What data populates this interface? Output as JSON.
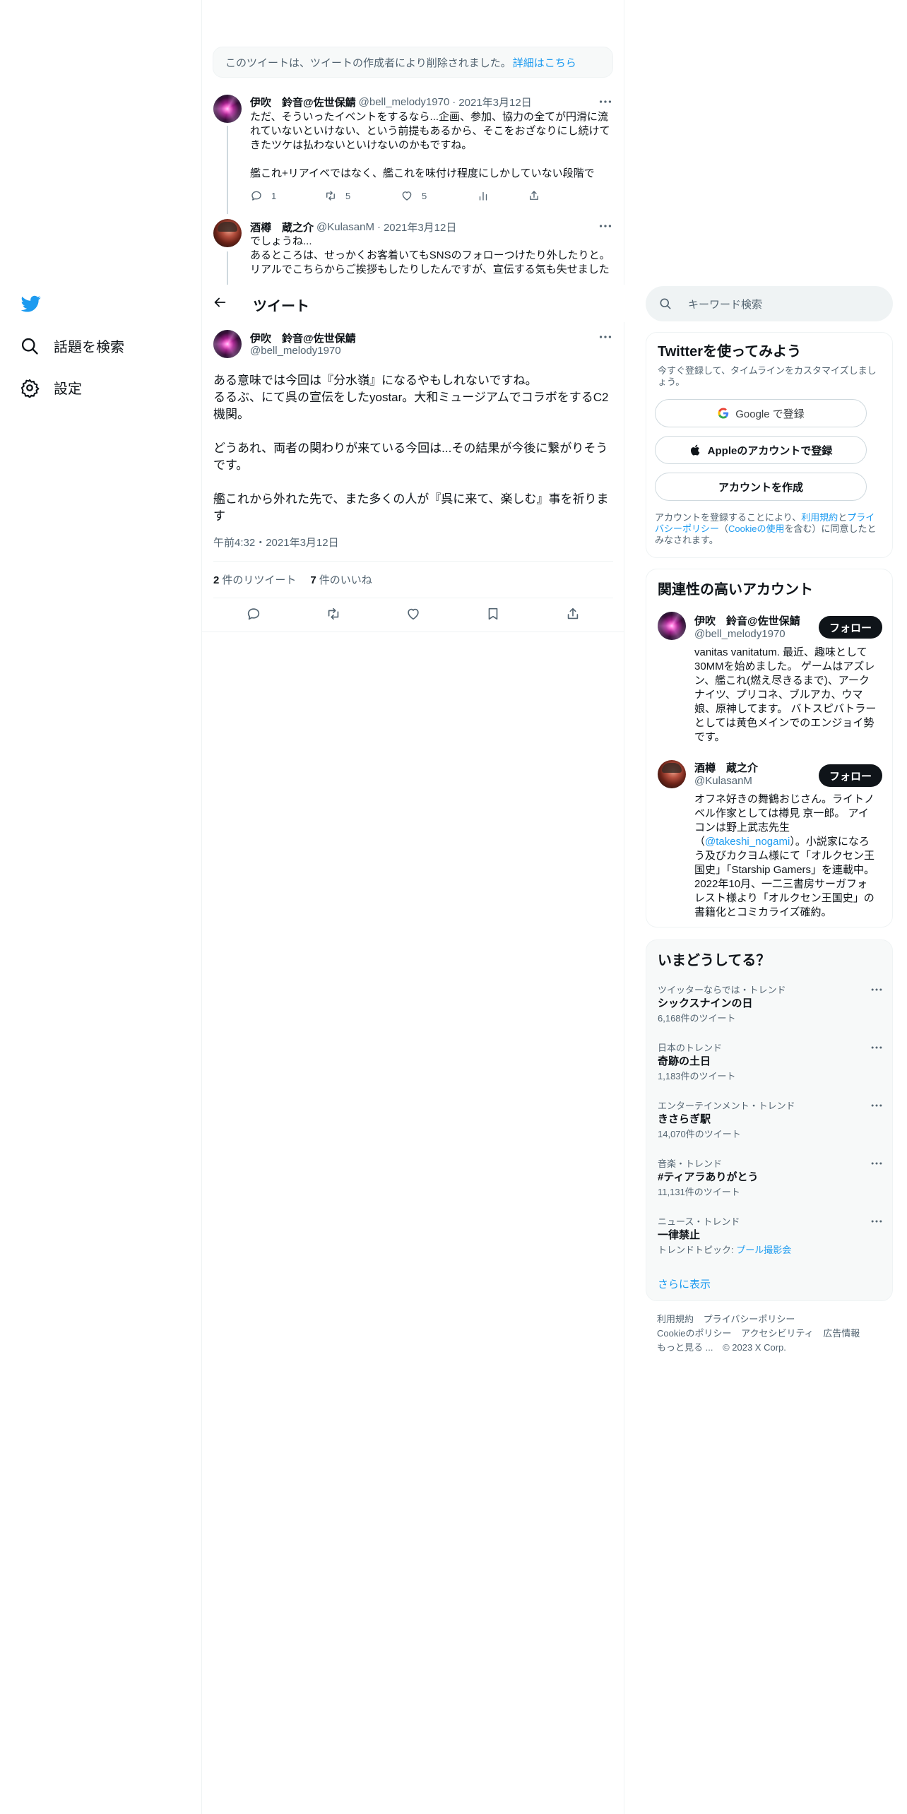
{
  "nav": {
    "items": [
      {
        "label": "話題を検索",
        "icon": "search-icon"
      },
      {
        "label": "設定",
        "icon": "gear-icon"
      }
    ]
  },
  "deleted_notice": {
    "text": "このツイートは、ツイートの作成者により削除されました。",
    "link": "詳細はこちら"
  },
  "thread": [
    {
      "name": "伊吹　鈴音@佐世保鯖",
      "handle": "@bell_melody1970",
      "date": "2021年3月12日",
      "text": "ただ、そういったイベントをするなら...企画、参加、協力の全てが円滑に流れていないといけない、という前提もあるから、そこをおざなりにし続けてきたツケは払わないといけないのかもですね。\n\n艦これ+リアイベではなく、艦これを味付け程度にしかしていない段階で",
      "replies": "1",
      "retweets": "5",
      "likes": "5"
    },
    {
      "name": "酒樽　蔵之介",
      "handle": "@KulasanM",
      "date": "2021年3月12日",
      "text": "でしょうね...\nあるところは、せっかくお客着いてもSNSのフォローつけたり外したりと。リアルでこちらからご挨拶もしたりしたんですが、宣伝する気も失せました"
    }
  ],
  "header": {
    "title": "ツイート"
  },
  "main_tweet": {
    "name": "伊吹　鈴音@佐世保鯖",
    "handle": "@bell_melody1970",
    "text": "ある意味では今回は『分水嶺』になるやもしれないですね。\nるるぶ、にて呉の宣伝をしたyostar。大和ミュージアムでコラボをするC2機関。\n\nどうあれ、両者の関わりが来ている今回は...その結果が今後に繋がりそうです。\n\n艦これから外れた先で、また多くの人が『呉に来て、楽しむ』事を祈ります",
    "time": "午前4:32・2021年3月12日",
    "retweet_count": "2",
    "retweet_label": "件のリツイート",
    "like_count": "7",
    "like_label": "件のいいね"
  },
  "search": {
    "placeholder": "キーワード検索"
  },
  "signup": {
    "title": "Twitterを使ってみよう",
    "subtitle": "今すぐ登録して、タイムラインをカスタマイズしましょう。",
    "google": "Google で登録",
    "apple": "Appleのアカウントで登録",
    "create": "アカウントを作成",
    "fine_1": "アカウントを登録することにより、",
    "terms": "利用規約",
    "and": "と",
    "privacy": "プライバシーポリシー",
    "paren_open": "（",
    "cookie": "Cookieの使用",
    "fine_2": "を含む）に同意したとみなされます。"
  },
  "related": {
    "title": "関連性の高いアカウント",
    "accounts": [
      {
        "name": "伊吹　鈴音@佐世保鯖",
        "handle": "@bell_melody1970",
        "follow": "フォロー",
        "bio": "vanitas vanitatum. 最近、趣味として30MMを始めました。 ゲームはアズレン、艦これ(燃え尽きるまで)、アークナイツ、プリコネ、ブルアカ、ウマ娘、原神してます。 バトスピバトラーとしては黄色メインでのエンジョイ勢です。"
      },
      {
        "name": "酒樽　蔵之介",
        "handle": "@KulasanM",
        "follow": "フォロー",
        "bio_1": "オフネ好きの舞鶴おじさん。ライトノベル作家としては樽見 京一郎。 アイコンは野上武志先生（",
        "bio_mention": "@takeshi_nogami",
        "bio_2": "）。小説家になろう及びカクヨム様にて「オルクセン王国史」「Starship Gamers」を連載中。 2022年10月、一二三書房サーガフォレスト様より「オルクセン王国史」の書籍化とコミカライズ確約。"
      }
    ]
  },
  "trends": {
    "title": "いまどうしてる？",
    "items": [
      {
        "meta": "ツイッターならでは・トレンド",
        "name": "シックスナインの日",
        "count": "6,168件のツイート"
      },
      {
        "meta": "日本のトレンド",
        "name": "奇跡の土日",
        "count": "1,183件のツイート"
      },
      {
        "meta": "エンターテインメント・トレンド",
        "name": "きさらぎ駅",
        "count": "14,070件のツイート"
      },
      {
        "meta": "音楽・トレンド",
        "name": "#ティアラありがとう",
        "count": "11,131件のツイート"
      },
      {
        "meta": "ニュース・トレンド",
        "name": "一律禁止",
        "count_prefix": "トレンドトピック: ",
        "count_link": "プール撮影会"
      }
    ],
    "show_more": "さらに表示"
  },
  "footer": {
    "links": [
      "利用規約",
      "プライバシーポリシー",
      "Cookieのポリシー",
      "アクセシビリティ",
      "広告情報",
      "もっと見る ..."
    ],
    "copyright": "© 2023 X Corp."
  },
  "colors": {
    "accent": "#1d9bf0",
    "text": "#0f1419",
    "muted": "#536471",
    "border": "#eff3f4"
  }
}
